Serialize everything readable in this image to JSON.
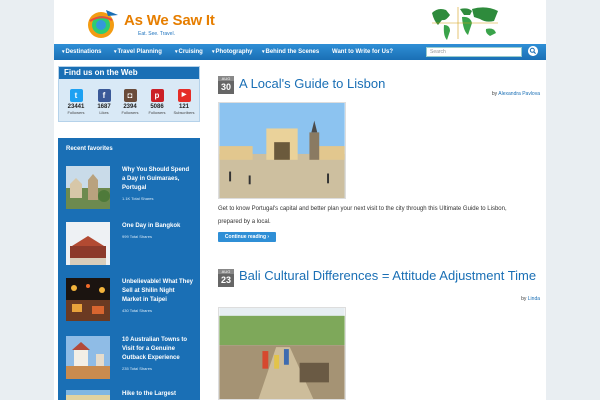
{
  "site": {
    "title": "As We Saw It",
    "tagline": "Eat. See. Travel."
  },
  "nav": {
    "items": [
      {
        "label": "Destinations"
      },
      {
        "label": "Travel Planning"
      },
      {
        "label": "Cruising"
      },
      {
        "label": "Photography"
      },
      {
        "label": "Behind the Scenes"
      },
      {
        "label": "Want to Write for Us?"
      }
    ],
    "search_placeholder": "Search"
  },
  "sidebar": {
    "find_title": "Find us on the Web",
    "social": [
      {
        "name": "twitter-icon",
        "glyph": "t",
        "color": "#1da1f2",
        "count": "23441",
        "label": "Followers"
      },
      {
        "name": "facebook-icon",
        "glyph": "f",
        "color": "#3b5998",
        "count": "1687",
        "label": "Likes"
      },
      {
        "name": "instagram-icon",
        "glyph": "◘",
        "color": "#6a4b3a",
        "count": "2394",
        "label": "Followers"
      },
      {
        "name": "pinterest-icon",
        "glyph": "p",
        "color": "#cb2027",
        "count": "5086",
        "label": "Followers"
      },
      {
        "name": "youtube-icon",
        "glyph": "▶",
        "color": "#e52d27",
        "count": "121",
        "label": "Subscribers"
      }
    ],
    "recent_title": "Recent favorites",
    "recent": [
      {
        "title": "Why You Should Spend a Day in Guimaraes, Portugal",
        "shares": "1.1K Total Shares"
      },
      {
        "title": "One Day in Bangkok",
        "shares": "999 Total Shares"
      },
      {
        "title": "Unbelievable! What They Sell at Shilin Night Market in Taipei",
        "shares": "430 Total Shares"
      },
      {
        "title": "10 Australian Towns to Visit for a Genuine Outback Experience",
        "shares": "235 Total Shares"
      },
      {
        "title": "Hike to the Largest",
        "shares": ""
      }
    ]
  },
  "posts": [
    {
      "month": "AUG",
      "day": "30",
      "title": "A Local's Guide to Lisbon",
      "by": "by",
      "author": "Alexandra Pavlova",
      "excerpt": "Get to know Portugal's capital and better plan your next visit to the city through this Ultimate Guide to Lisbon, prepared by a local.",
      "more": "Continue reading ›"
    },
    {
      "month": "AUG",
      "day": "23",
      "title": "Bali Cultural Differences = Attitude Adjustment Time",
      "by": "by",
      "author": "Linda"
    }
  ],
  "colors": {
    "brand_blue": "#1a6fb5",
    "logo_orange": "#e67e00"
  }
}
